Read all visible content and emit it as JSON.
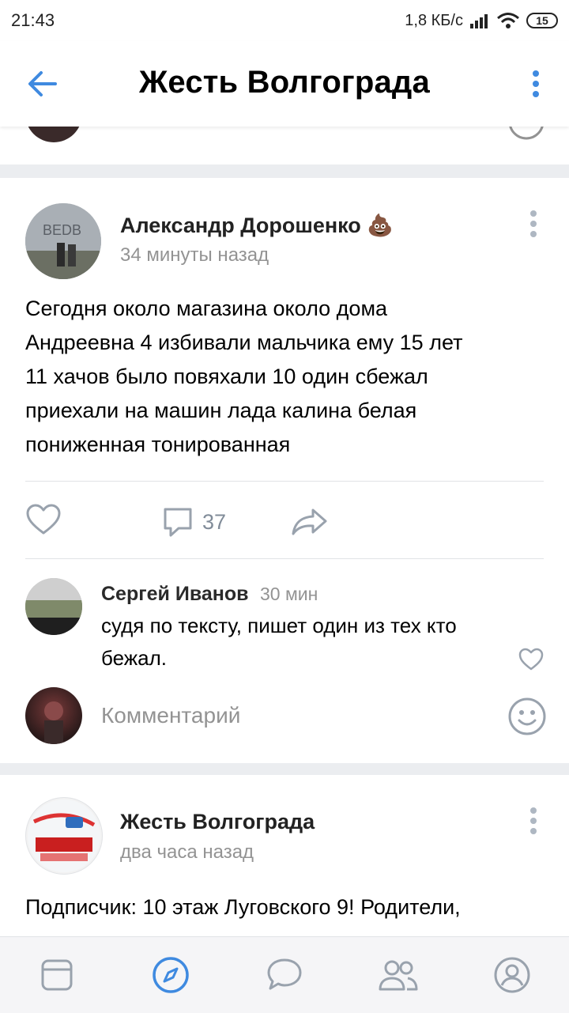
{
  "status_bar": {
    "time": "21:43",
    "network_speed": "1,8 КБ/с",
    "battery": "15"
  },
  "header": {
    "title": "Жесть Волгограда",
    "back_icon": "arrow-left-icon",
    "menu_icon": "more-vertical-icon"
  },
  "post": {
    "author": "Александр Дорошенко",
    "author_emoji": "💩",
    "time": "34 минуты назад",
    "text_lines": [
      "Сегодня около магазина около дома",
      "Андреевна 4 избивали мальчика ему 15 лет",
      "11 хачов было повяхали 10 один сбежал",
      "приехали на машин лада калина белая",
      "пониженная тонированная"
    ],
    "comments_count": "37",
    "comment": {
      "author": "Сергей Иванов",
      "time": "30 мин",
      "text_lines": [
        "судя по тексту, пишет один из тех кто",
        "бежал."
      ]
    },
    "comment_placeholder": "Комментарий"
  },
  "post2": {
    "author": "Жесть Волгограда",
    "time": "два часа назад",
    "text": "Подписчик: 10 этаж Луговского 9! Родители,"
  },
  "colors": {
    "accent": "#3f8ae0",
    "secondary": "#818c99",
    "muted": "#939393"
  },
  "bottom_nav": [
    {
      "name": "news-icon",
      "active": false
    },
    {
      "name": "explore-icon",
      "active": true
    },
    {
      "name": "messages-icon",
      "active": false
    },
    {
      "name": "friends-icon",
      "active": false
    },
    {
      "name": "profile-icon",
      "active": false
    }
  ]
}
